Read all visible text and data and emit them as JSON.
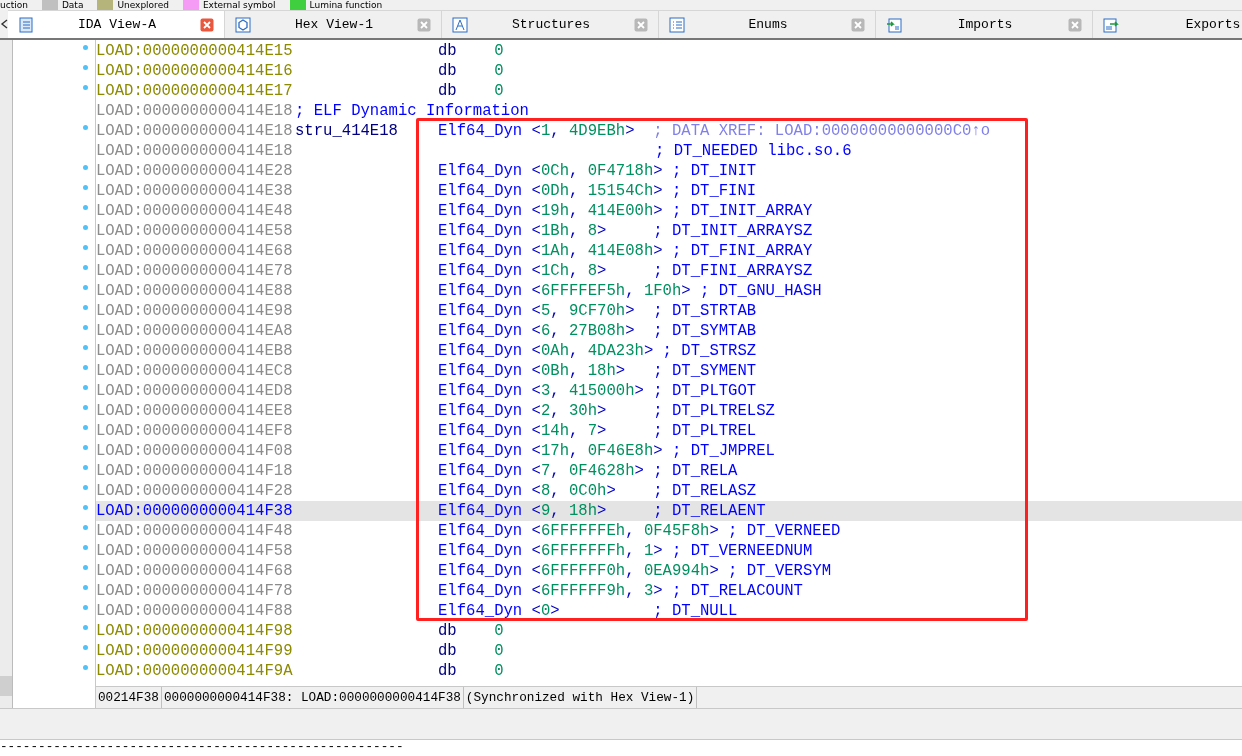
{
  "legend": [
    {
      "label": "uction"
    },
    {
      "label": "Data",
      "color": "#c0c0c0"
    },
    {
      "label": "Unexplored",
      "color": "#b5b47a"
    },
    {
      "label": "External symbol",
      "color": "#f59af5"
    },
    {
      "label": "Lumina function",
      "color": "#3fcf3f"
    }
  ],
  "tabs": [
    {
      "label": "IDA View-A",
      "selected": true
    },
    {
      "label": "Hex View-1",
      "selected": false
    },
    {
      "label": "Structures",
      "selected": false
    },
    {
      "label": "Enums",
      "selected": false
    },
    {
      "label": "Imports",
      "selected": false
    },
    {
      "label": "Exports",
      "selected": false
    }
  ],
  "lines": [
    {
      "kind": "byte",
      "dot": true,
      "selected": false,
      "address": "LOAD:0000000000414E15",
      "mnemonic": "db",
      "operand": "0"
    },
    {
      "kind": "byte",
      "dot": true,
      "selected": false,
      "address": "LOAD:0000000000414E16",
      "mnemonic": "db",
      "operand": "0"
    },
    {
      "kind": "byte",
      "dot": true,
      "selected": false,
      "address": "LOAD:0000000000414E17",
      "mnemonic": "db",
      "operand": "0"
    },
    {
      "kind": "plain",
      "dot": false,
      "selected": false,
      "address": "LOAD:0000000000414E18",
      "label_comment": "; ELF Dynamic Information"
    },
    {
      "kind": "plain",
      "dot": true,
      "selected": false,
      "address": "LOAD:0000000000414E18",
      "label": "stru_414E18",
      "mnemonic": "Elf64_Dyn",
      "operand": "<1, 4D9EBh>",
      "comment": "; DATA XREF: LOAD:00000000000000C0↑o",
      "color": "#8080e8"
    },
    {
      "kind": "plain",
      "dot": false,
      "selected": false,
      "address": "LOAD:0000000000414E18",
      "comment": "; DT_NEEDED libc.so.6",
      "color": "#0000ff"
    },
    {
      "kind": "plain",
      "dot": true,
      "selected": false,
      "address": "LOAD:0000000000414E28",
      "mnemonic": "Elf64_Dyn",
      "operand": "<0Ch, 0F4718h>",
      "comment": "; DT_INIT",
      "color": "#0000ff"
    },
    {
      "kind": "plain",
      "dot": true,
      "selected": false,
      "address": "LOAD:0000000000414E38",
      "mnemonic": "Elf64_Dyn",
      "operand": "<0Dh, 15154Ch>",
      "comment": "; DT_FINI",
      "color": "#0000ff"
    },
    {
      "kind": "plain",
      "dot": true,
      "selected": false,
      "address": "LOAD:0000000000414E48",
      "mnemonic": "Elf64_Dyn",
      "operand": "<19h, 414E00h>",
      "comment": "; DT_INIT_ARRAY",
      "color": "#0000ff"
    },
    {
      "kind": "plain",
      "dot": true,
      "selected": false,
      "address": "LOAD:0000000000414E58",
      "mnemonic": "Elf64_Dyn",
      "operand": "<1Bh, 8>",
      "comment": "; DT_INIT_ARRAYSZ",
      "color": "#0000ff"
    },
    {
      "kind": "plain",
      "dot": true,
      "selected": false,
      "address": "LOAD:0000000000414E68",
      "mnemonic": "Elf64_Dyn",
      "operand": "<1Ah, 414E08h>",
      "comment": "; DT_FINI_ARRAY",
      "color": "#0000ff"
    },
    {
      "kind": "plain",
      "dot": true,
      "selected": false,
      "address": "LOAD:0000000000414E78",
      "mnemonic": "Elf64_Dyn",
      "operand": "<1Ch, 8>",
      "comment": "; DT_FINI_ARRAYSZ",
      "color": "#0000ff"
    },
    {
      "kind": "plain",
      "dot": true,
      "selected": false,
      "address": "LOAD:0000000000414E88",
      "mnemonic": "Elf64_Dyn",
      "operand": "<6FFFFEF5h, 1F0h>",
      "comment": "; DT_GNU_HASH",
      "color": "#0000ff"
    },
    {
      "kind": "plain",
      "dot": true,
      "selected": false,
      "address": "LOAD:0000000000414E98",
      "mnemonic": "Elf64_Dyn",
      "operand": "<5, 9CF70h>",
      "comment": "; DT_STRTAB",
      "color": "#0000ff"
    },
    {
      "kind": "plain",
      "dot": true,
      "selected": false,
      "address": "LOAD:0000000000414EA8",
      "mnemonic": "Elf64_Dyn",
      "operand": "<6, 27B08h>",
      "comment": "; DT_SYMTAB",
      "color": "#0000ff"
    },
    {
      "kind": "plain",
      "dot": true,
      "selected": false,
      "address": "LOAD:0000000000414EB8",
      "mnemonic": "Elf64_Dyn",
      "operand": "<0Ah, 4DA23h>",
      "comment": "; DT_STRSZ",
      "color": "#0000ff"
    },
    {
      "kind": "plain",
      "dot": true,
      "selected": false,
      "address": "LOAD:0000000000414EC8",
      "mnemonic": "Elf64_Dyn",
      "operand": "<0Bh, 18h>",
      "comment": "; DT_SYMENT",
      "color": "#0000ff"
    },
    {
      "kind": "plain",
      "dot": true,
      "selected": false,
      "address": "LOAD:0000000000414ED8",
      "mnemonic": "Elf64_Dyn",
      "operand": "<3, 415000h>",
      "comment": "; DT_PLTGOT",
      "color": "#0000ff"
    },
    {
      "kind": "plain",
      "dot": true,
      "selected": false,
      "address": "LOAD:0000000000414EE8",
      "mnemonic": "Elf64_Dyn",
      "operand": "<2, 30h>",
      "comment": "; DT_PLTRELSZ",
      "color": "#0000ff"
    },
    {
      "kind": "plain",
      "dot": true,
      "selected": false,
      "address": "LOAD:0000000000414EF8",
      "mnemonic": "Elf64_Dyn",
      "operand": "<14h, 7>",
      "comment": "; DT_PLTREL",
      "color": "#0000ff"
    },
    {
      "kind": "plain",
      "dot": true,
      "selected": false,
      "address": "LOAD:0000000000414F08",
      "mnemonic": "Elf64_Dyn",
      "operand": "<17h, 0F46E8h>",
      "comment": "; DT_JMPREL",
      "color": "#0000ff"
    },
    {
      "kind": "plain",
      "dot": true,
      "selected": false,
      "address": "LOAD:0000000000414F18",
      "mnemonic": "Elf64_Dyn",
      "operand": "<7, 0F4628h>",
      "comment": "; DT_RELA",
      "color": "#0000ff"
    },
    {
      "kind": "plain",
      "dot": true,
      "selected": false,
      "address": "LOAD:0000000000414F28",
      "mnemonic": "Elf64_Dyn",
      "operand": "<8, 0C0h>",
      "comment": "; DT_RELASZ",
      "color": "#0000ff"
    },
    {
      "kind": "plain",
      "dot": true,
      "selected": true,
      "address": "LOAD:0000000000414F38",
      "mnemonic": "Elf64_Dyn",
      "operand": "<9, 18h>",
      "comment": "; DT_RELAENT",
      "color": "#0000ff"
    },
    {
      "kind": "plain",
      "dot": true,
      "selected": false,
      "address": "LOAD:0000000000414F48",
      "mnemonic": "Elf64_Dyn",
      "operand": "<6FFFFFFEh, 0F45F8h>",
      "comment": "; DT_VERNEED",
      "color": "#0000ff"
    },
    {
      "kind": "plain",
      "dot": true,
      "selected": false,
      "address": "LOAD:0000000000414F58",
      "mnemonic": "Elf64_Dyn",
      "operand": "<6FFFFFFFh, 1>",
      "comment": "; DT_VERNEEDNUM",
      "color": "#0000ff"
    },
    {
      "kind": "plain",
      "dot": true,
      "selected": false,
      "address": "LOAD:0000000000414F68",
      "mnemonic": "Elf64_Dyn",
      "operand": "<6FFFFFF0h, 0EA994h>",
      "comment": "; DT_VERSYM",
      "color": "#0000ff"
    },
    {
      "kind": "plain",
      "dot": true,
      "selected": false,
      "address": "LOAD:0000000000414F78",
      "mnemonic": "Elf64_Dyn",
      "operand": "<6FFFFFF9h, 3>",
      "comment": "; DT_RELACOUNT",
      "color": "#0000ff"
    },
    {
      "kind": "plain",
      "dot": true,
      "selected": false,
      "address": "LOAD:0000000000414F88",
      "mnemonic": "Elf64_Dyn",
      "operand": "<0>",
      "comment": "; DT_NULL",
      "color": "#0000ff"
    },
    {
      "kind": "byte",
      "dot": true,
      "selected": false,
      "address": "LOAD:0000000000414F98",
      "mnemonic": "db",
      "operand": "0"
    },
    {
      "kind": "byte",
      "dot": true,
      "selected": false,
      "address": "LOAD:0000000000414F99",
      "mnemonic": "db",
      "operand": "0"
    },
    {
      "kind": "byte",
      "dot": true,
      "selected": false,
      "address": "LOAD:0000000000414F9A",
      "mnemonic": "db",
      "operand": "0"
    }
  ],
  "status_bar": [
    "00214F38",
    "0000000000414F38: LOAD:0000000000414F38",
    "(Synchronized with Hex View-1)"
  ],
  "output": {
    "text": "-----------------------------------------------------"
  }
}
